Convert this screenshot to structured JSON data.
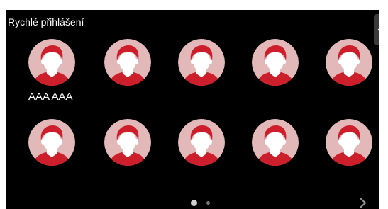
{
  "header": {
    "title": "Rychlé přihlášení"
  },
  "users": [
    {
      "name": "AAA AAA"
    },
    {
      "name": ""
    },
    {
      "name": ""
    },
    {
      "name": ""
    },
    {
      "name": ""
    },
    {
      "name": ""
    },
    {
      "name": ""
    },
    {
      "name": ""
    },
    {
      "name": ""
    },
    {
      "name": ""
    }
  ],
  "pagination": {
    "pages": 2,
    "current_page": 1
  },
  "icons": {
    "avatar": "user-avatar-icon",
    "side_tab": "chevron-left-icon",
    "next": "chevron-right-icon"
  },
  "colors": {
    "background": "#000000",
    "avatar_circle": "#e3b8b8",
    "avatar_hair": "#cc1f2b",
    "avatar_shirt": "#cc1f2b",
    "avatar_face": "#ffffff"
  }
}
